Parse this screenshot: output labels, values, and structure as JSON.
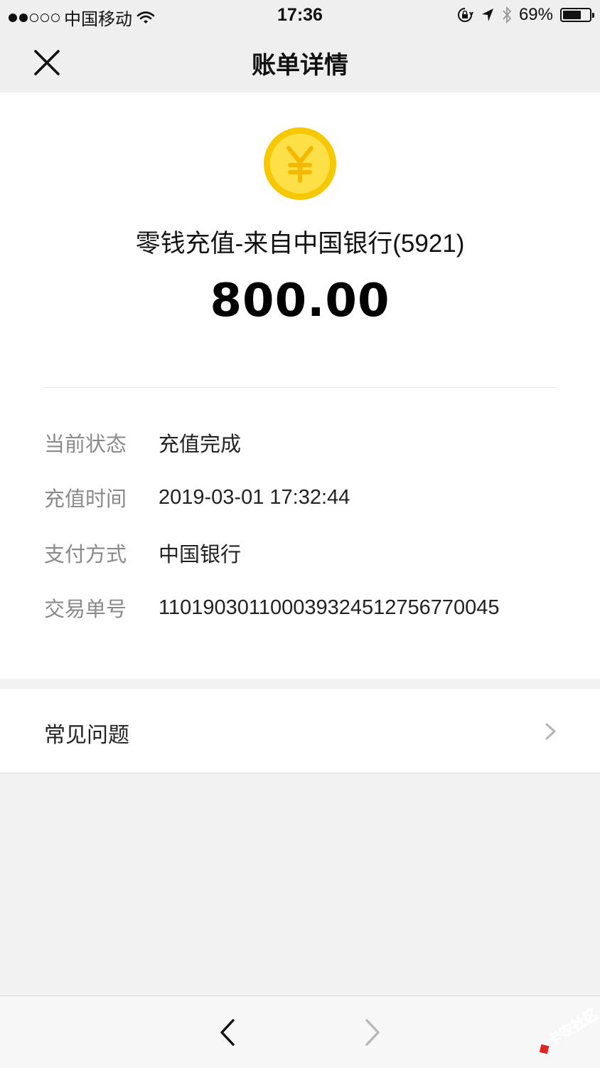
{
  "status_bar": {
    "carrier": "中国移动",
    "time": "17:36",
    "battery": "69%",
    "battery_level": 0.69,
    "signal_strength": 2,
    "signal_max": 5,
    "icons": [
      "wifi-icon",
      "rotation-lock-icon",
      "location-arrow-icon",
      "bluetooth-icon",
      "battery-icon"
    ]
  },
  "nav": {
    "title": "账单详情",
    "close_icon": "close-icon"
  },
  "bill": {
    "icon": "yuan-coin-icon",
    "merchant": "零钱充值-来自中国银行(5921)",
    "amount": "800.00",
    "details": [
      {
        "label": "当前状态",
        "value": "充值完成"
      },
      {
        "label": "充值时间",
        "value": "2019-03-01 17:32:44"
      },
      {
        "label": "支付方式",
        "value": "中国银行"
      },
      {
        "label": "交易单号",
        "value": "110190301100039324512756770045"
      }
    ]
  },
  "faq": {
    "label": "常见问题",
    "icon": "chevron-right-icon"
  },
  "toolbar": {
    "back_icon": "back-arrow-icon",
    "forward_icon": "forward-arrow-icon"
  },
  "watermark": {
    "text": "卡农社区"
  },
  "colors": {
    "coin": "#fdd835",
    "coin_ring": "#f5c800",
    "label_gray": "#8a8a8a",
    "background": "#f2f2f2"
  }
}
